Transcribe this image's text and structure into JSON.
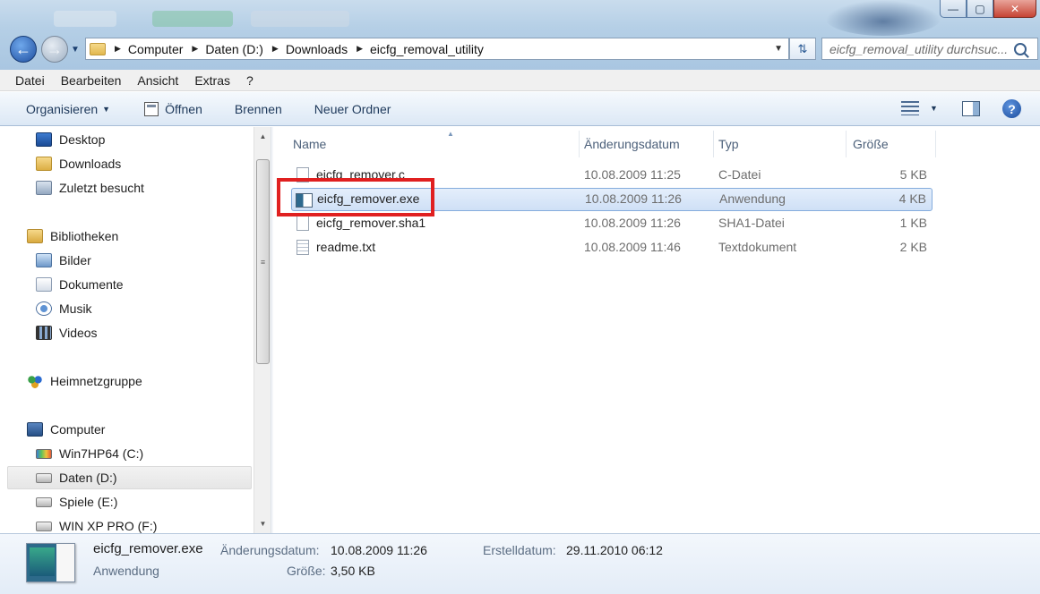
{
  "window": {
    "minimize_label": "—",
    "maximize_label": "▢",
    "close_label": "✕"
  },
  "address": {
    "crumbs": [
      "Computer",
      "Daten (D:)",
      "Downloads",
      "eicfg_removal_utility"
    ],
    "search_placeholder": "eicfg_removal_utility durchsuc..."
  },
  "menu": [
    "Datei",
    "Bearbeiten",
    "Ansicht",
    "Extras",
    "?"
  ],
  "toolbar": {
    "organize": "Organisieren",
    "open": "Öffnen",
    "burn": "Brennen",
    "new_folder": "Neuer Ordner"
  },
  "nav": {
    "favorites": [
      {
        "label": "Desktop",
        "icon": "desktop-icon"
      },
      {
        "label": "Downloads",
        "icon": "downloads-folder-icon"
      },
      {
        "label": "Zuletzt besucht",
        "icon": "recent-places-icon"
      }
    ],
    "libraries_header": "Bibliotheken",
    "libraries": [
      {
        "label": "Bilder",
        "icon": "pictures-icon"
      },
      {
        "label": "Dokumente",
        "icon": "documents-icon"
      },
      {
        "label": "Musik",
        "icon": "music-icon"
      },
      {
        "label": "Videos",
        "icon": "videos-icon"
      }
    ],
    "homegroup": "Heimnetzgruppe",
    "computer_header": "Computer",
    "drives": [
      {
        "label": "Win7HP64 (C:)",
        "icon": "windows-drive-icon"
      },
      {
        "label": "Daten (D:)",
        "icon": "drive-icon",
        "selected": true
      },
      {
        "label": "Spiele (E:)",
        "icon": "drive-icon"
      },
      {
        "label": "WIN XP PRO (F:)",
        "icon": "drive-icon"
      }
    ]
  },
  "columns": {
    "name": "Name",
    "date": "Änderungsdatum",
    "type": "Typ",
    "size": "Größe"
  },
  "files": [
    {
      "name": "eicfg_remover.c",
      "date": "10.08.2009 11:25",
      "type": "C-Datei",
      "size": "5 KB",
      "icon": "c-file-icon"
    },
    {
      "name": "eicfg_remover.exe",
      "date": "10.08.2009 11:26",
      "type": "Anwendung",
      "size": "4 KB",
      "icon": "exe-file-icon",
      "selected": true
    },
    {
      "name": "eicfg_remover.sha1",
      "date": "10.08.2009 11:26",
      "type": "SHA1-Datei",
      "size": "1 KB",
      "icon": "sha1-file-icon"
    },
    {
      "name": "readme.txt",
      "date": "10.08.2009 11:46",
      "type": "Textdokument",
      "size": "2 KB",
      "icon": "text-file-icon"
    }
  ],
  "details": {
    "name": "eicfg_remover.exe",
    "kind": "Anwendung",
    "modified_label": "Änderungsdatum:",
    "modified_value": "10.08.2009 11:26",
    "size_label": "Größe:",
    "size_value": "3,50 KB",
    "created_label": "Erstelldatum:",
    "created_value": "29.11.2010 06:12"
  },
  "colors": {
    "highlight_box": "#e02020",
    "selection": "#cfe0f6"
  }
}
